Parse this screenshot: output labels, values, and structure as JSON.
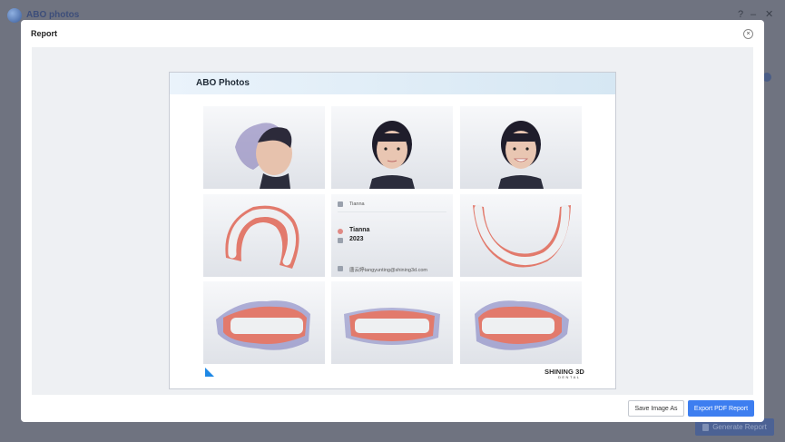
{
  "app": {
    "title": "ABO photos",
    "help": "?",
    "minimize": "–",
    "close": "✕",
    "background_button": "Generate Report"
  },
  "modal": {
    "title": "Report",
    "close_glyph": "×"
  },
  "report": {
    "title": "ABO Photos",
    "info": {
      "clinic": "Tianna",
      "patient_name": "Tianna",
      "year": "2023",
      "doctor": "唐云婷tangyunting@shining3d.com"
    },
    "brand": "SHINING 3D",
    "brand_sub": "DENTAL"
  },
  "footer": {
    "save_label": "Save Image As",
    "export_label": "Export PDF Report"
  },
  "colors": {
    "accent": "#3d7ef0",
    "header_gradient_start": "#eaf3fb",
    "header_gradient_end": "#d6e7f3",
    "gum": "#e27a6c",
    "teeth": "#eef0f2",
    "brand_mark": "#1e88e5"
  }
}
